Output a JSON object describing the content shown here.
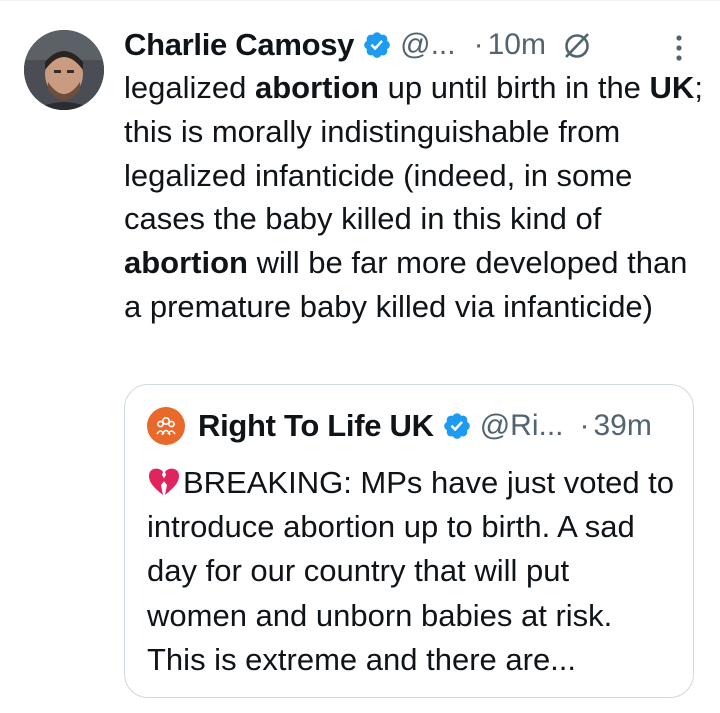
{
  "tweet": {
    "author_name": "Charlie Camosy",
    "handle": "@...",
    "separator": "·",
    "time": "10m",
    "body_segments": [
      {
        "text": "legalized ",
        "bold": false
      },
      {
        "text": "abortion",
        "bold": true
      },
      {
        "text": " up until birth in the ",
        "bold": false
      },
      {
        "text": "UK",
        "bold": true
      },
      {
        "text": "; this is morally indistinguishable from legalized infanticide (indeed, in some cases the baby killed in this kind of ",
        "bold": false
      },
      {
        "text": "abortion",
        "bold": true
      },
      {
        "text": " will be far more developed than a premature baby killed via infanticide)",
        "bold": false
      }
    ]
  },
  "quoted_tweet": {
    "author_name": "Right To Life UK",
    "handle": "@Ri...",
    "separator": "·",
    "time": "39m",
    "body": "BREAKING: MPs have just voted to introduce abortion up to birth. A sad day for our country that will put women and unborn babies at risk. This is extreme and there are..."
  },
  "icons": {
    "avatar": "avatar",
    "verified": "verified-badge-icon",
    "no_reply": "no-reply-icon",
    "more": "more-options-icon",
    "broken_heart": "broken-heart-icon",
    "org_logo": "right-to-life-logo"
  },
  "colors": {
    "verified_blue": "#1d9bf0",
    "secondary_text": "#536471",
    "border": "#cfd9de",
    "logo_orange": "#e8692a",
    "broken_heart": "#e0245e"
  }
}
